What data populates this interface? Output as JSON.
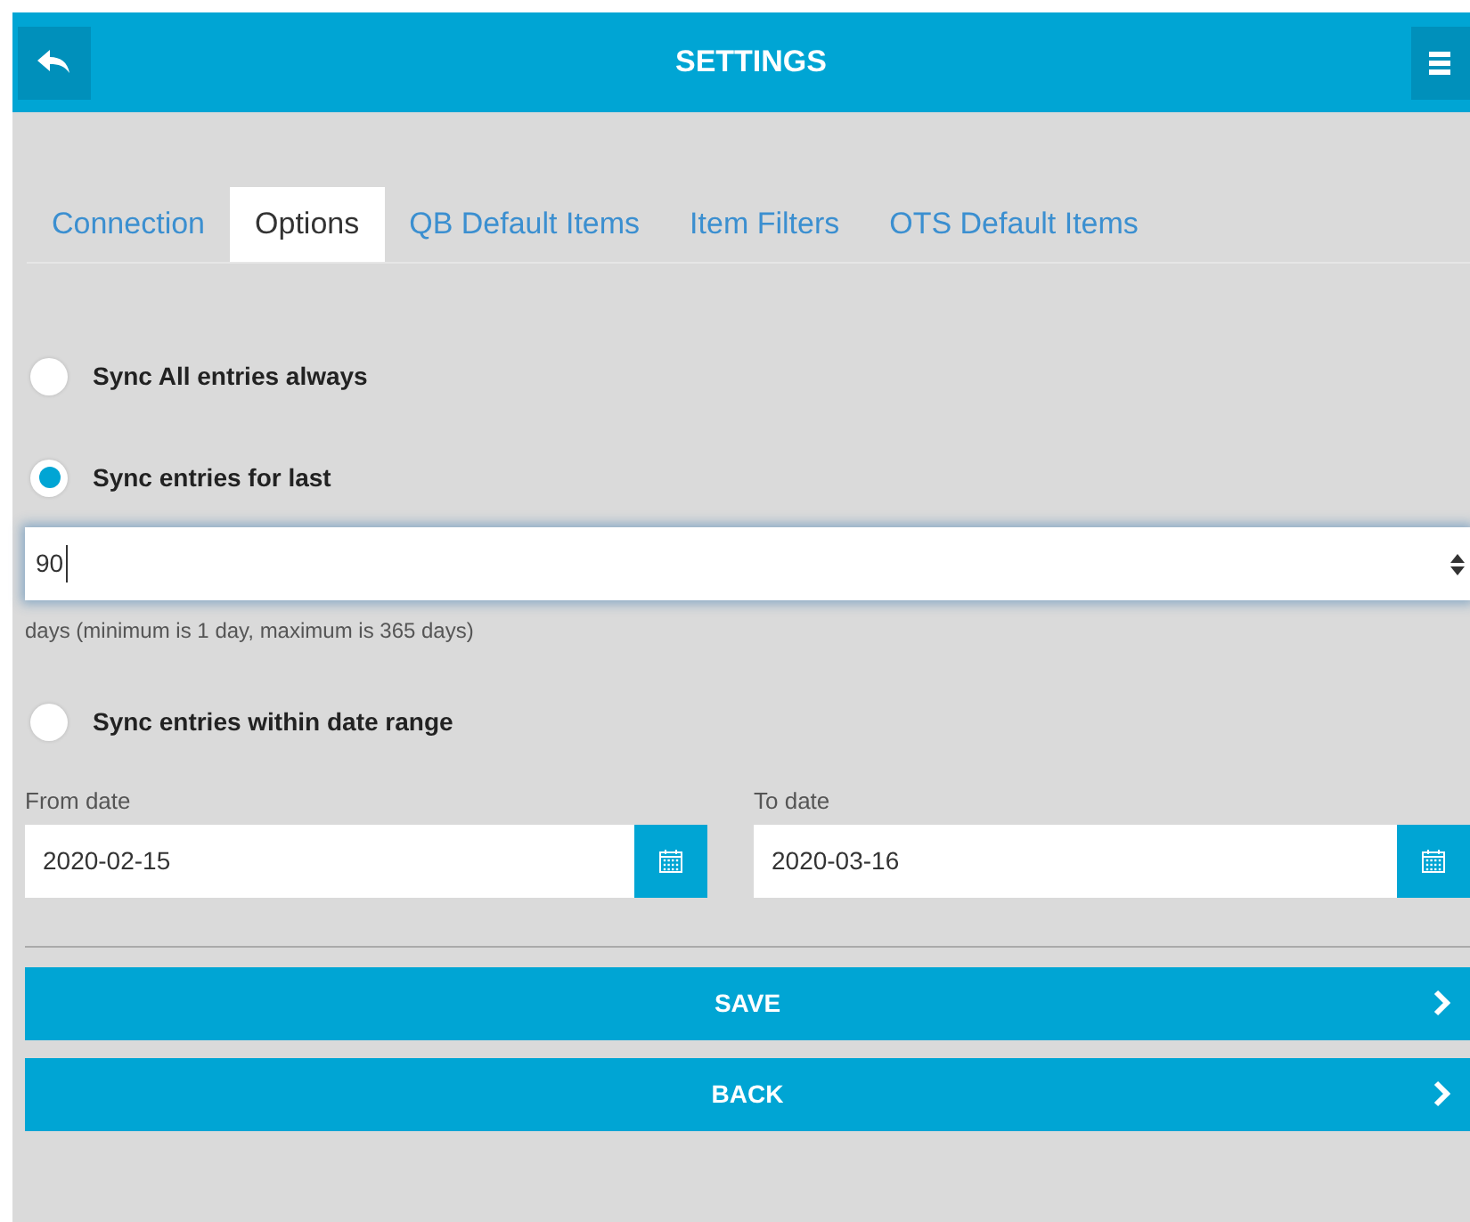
{
  "header": {
    "title": "SETTINGS"
  },
  "tabs": [
    {
      "label": "Connection",
      "selected": false
    },
    {
      "label": "Options",
      "selected": true
    },
    {
      "label": "QB Default Items",
      "selected": false
    },
    {
      "label": "Item Filters",
      "selected": false
    },
    {
      "label": "OTS Default Items",
      "selected": false
    }
  ],
  "sync_options": [
    {
      "label": "Sync All entries always",
      "selected": false
    },
    {
      "label": "Sync entries for last",
      "selected": true,
      "field": {
        "value": "90",
        "hint": "days (minimum is 1 day, maximum is 365 days)"
      }
    },
    {
      "label": "Sync entries within date range",
      "selected": false
    }
  ],
  "date_range": [
    {
      "label": "From date",
      "value": "2020-02-15"
    },
    {
      "label": "To date",
      "value": "2020-03-16"
    }
  ],
  "buttons": [
    "SAVE",
    "BACK"
  ]
}
